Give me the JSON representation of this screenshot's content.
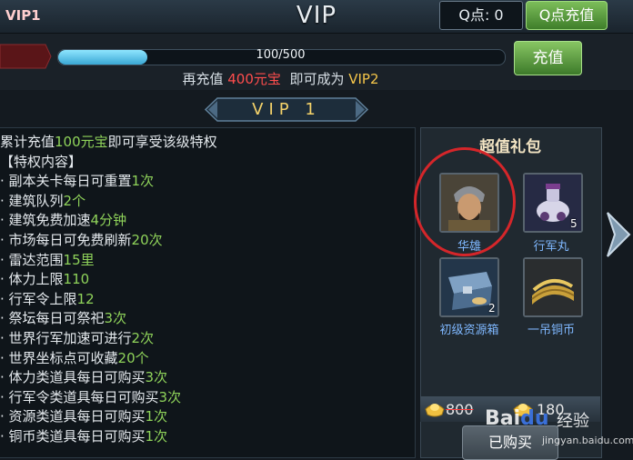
{
  "header": {
    "title": "VIP",
    "q_points": "Q点: 0",
    "q_recharge_label": "Q点充值"
  },
  "vip": {
    "current_badge": "VIP1",
    "progress_text": "100/500",
    "progress_fraction": 0.2,
    "hint_prefix": "再充值 ",
    "hint_amount": "400元宝",
    "hint_middle": "  即可成为 ",
    "hint_target": "VIP2",
    "recharge_label": "充值"
  },
  "level_banner": "VIP 1",
  "privileges": {
    "lines": [
      {
        "text": "累计充值",
        "value": "100元宝",
        "suffix": "即可享受该级特权"
      },
      {
        "text": "【特权内容】",
        "value": "",
        "suffix": ""
      },
      {
        "text": "· 副本关卡每日可重置",
        "value": "1次",
        "suffix": ""
      },
      {
        "text": "· 建筑队列",
        "value": "2个",
        "suffix": ""
      },
      {
        "text": "· 建筑免费加速",
        "value": "4分钟",
        "suffix": ""
      },
      {
        "text": "· 市场每日可免费刷新",
        "value": "20次",
        "suffix": ""
      },
      {
        "text": "· 雷达范围",
        "value": "15里",
        "suffix": ""
      },
      {
        "text": "· 体力上限",
        "value": "110",
        "suffix": ""
      },
      {
        "text": "· 行军令上限",
        "value": "12",
        "suffix": ""
      },
      {
        "text": "· 祭坛每日可祭祀",
        "value": "3次",
        "suffix": ""
      },
      {
        "text": "· 世界行军加速可进行",
        "value": "2次",
        "suffix": ""
      },
      {
        "text": "· 世界坐标点可收藏",
        "value": "20个",
        "suffix": ""
      },
      {
        "text": "· 体力类道具每日可购买",
        "value": "3次",
        "suffix": ""
      },
      {
        "text": "· 行军令类道具每日可购买",
        "value": "3次",
        "suffix": ""
      },
      {
        "text": "· 资源类道具每日可购买",
        "value": "1次",
        "suffix": ""
      },
      {
        "text": "· 铜币类道具每日可购买",
        "value": "1次",
        "suffix": ""
      }
    ]
  },
  "gift_pack": {
    "title": "超值礼包",
    "items": [
      {
        "label": "华雄",
        "count": "",
        "icon": "general-portrait-icon"
      },
      {
        "label": "行军丸",
        "count": "5",
        "icon": "march-pill-icon"
      },
      {
        "label": "初级资源箱",
        "count": "2",
        "icon": "resource-chest-icon"
      },
      {
        "label": "一吊铜币",
        "count": "",
        "icon": "copper-coins-icon"
      }
    ],
    "original_price": "800",
    "price": "180",
    "purchased_label": "已购买"
  },
  "watermark": {
    "logo": "Bai",
    "logo_accent": "du",
    "suffix": "经验",
    "url": "jingyan.baidu.com"
  },
  "colors": {
    "accent_green": "#8fd35a",
    "accent_red": "#ff4d4d",
    "accent_gold": "#f4c54a",
    "progress_blue": "#3aa7d4"
  }
}
